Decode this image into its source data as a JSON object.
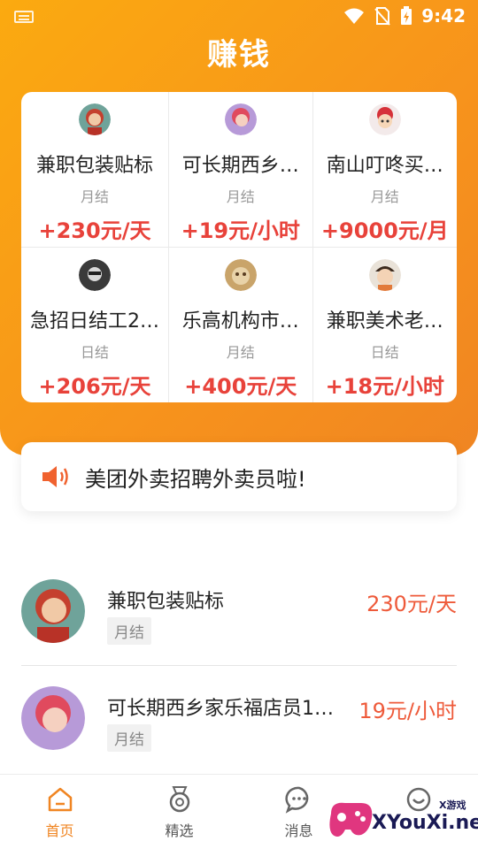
{
  "status": {
    "time": "9:42"
  },
  "page": {
    "title": "赚钱"
  },
  "grid": [
    {
      "title": "兼职包装贴标",
      "settle": "月结",
      "pay": "+230元/天",
      "avatar": "avatar-red"
    },
    {
      "title": "可长期西乡…",
      "settle": "月结",
      "pay": "+19元/小时",
      "avatar": "avatar-purple"
    },
    {
      "title": "南山叮咚买…",
      "settle": "月结",
      "pay": "+9000元/月",
      "avatar": "avatar-doll"
    },
    {
      "title": "急招日结工2…",
      "settle": "日结",
      "pay": "+206元/天",
      "avatar": "avatar-dark"
    },
    {
      "title": "乐高机构市…",
      "settle": "月结",
      "pay": "+400元/天",
      "avatar": "avatar-plush"
    },
    {
      "title": "兼职美术老…",
      "settle": "日结",
      "pay": "+18元/小时",
      "avatar": "avatar-baby"
    }
  ],
  "notice": {
    "text": "美团外卖招聘外卖员啦!"
  },
  "jobs": [
    {
      "title": "兼职包装贴标",
      "tag": "月结",
      "pay": "230元/天"
    },
    {
      "title": "可长期西乡家乐福店员1…",
      "tag": "月结",
      "pay": "19元/小时"
    }
  ],
  "tabs": [
    {
      "label": "首页",
      "icon": "home-icon",
      "active": true
    },
    {
      "label": "精选",
      "icon": "medal-icon",
      "active": false
    },
    {
      "label": "消息",
      "icon": "chat-icon",
      "active": false
    },
    {
      "label": "",
      "icon": "profile-icon",
      "active": false
    }
  ],
  "watermark": {
    "text": "XYouXi.net",
    "small": "X游戏"
  },
  "colors": {
    "accent": "#f7931c",
    "pay_red": "#e8423a",
    "tab_active": "#f08522"
  }
}
